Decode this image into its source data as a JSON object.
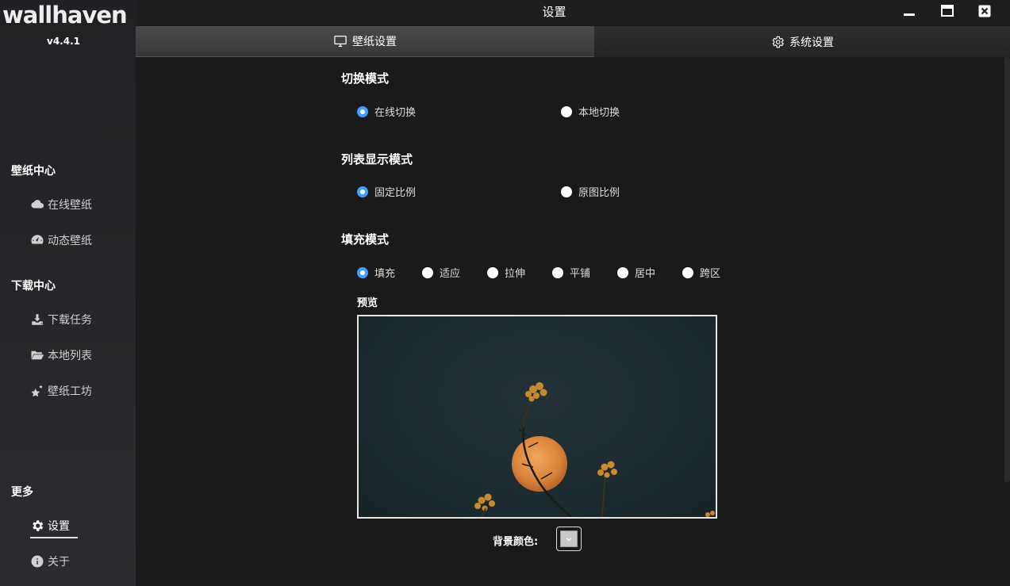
{
  "sidebar": {
    "logo": "wallhaven",
    "version": "v4.4.1",
    "section_wallpaper": "壁纸中心",
    "online_wallpaper": "在线壁纸",
    "dynamic_wallpaper": "动态壁纸",
    "section_download": "下载中心",
    "download_tasks": "下载任务",
    "local_list": "本地列表",
    "wallpaper_workshop": "壁纸工坊",
    "section_more": "更多",
    "settings": "设置",
    "about": "关于"
  },
  "titlebar": {
    "title": "设置"
  },
  "tabs": {
    "wallpaper_settings": "壁纸设置",
    "system_settings": "系统设置"
  },
  "settings": {
    "switch_mode": {
      "title": "切换模式",
      "options": [
        "在线切换",
        "本地切换"
      ],
      "selected": "在线切换"
    },
    "list_mode": {
      "title": "列表显示模式",
      "options": [
        "固定比例",
        "原图比例"
      ],
      "selected": "固定比例"
    },
    "fill_mode": {
      "title": "填充模式",
      "options": [
        "填充",
        "适应",
        "拉伸",
        "平铺",
        "居中",
        "跨区"
      ],
      "selected": "填充"
    },
    "preview_label": "预览",
    "bg_color_label": "背景颜色:",
    "bg_color": "#c8c8c8"
  },
  "colors": {
    "accent": "#409eff",
    "sidebar_bg": "#24262a",
    "content_bg": "#1a1a1a"
  }
}
